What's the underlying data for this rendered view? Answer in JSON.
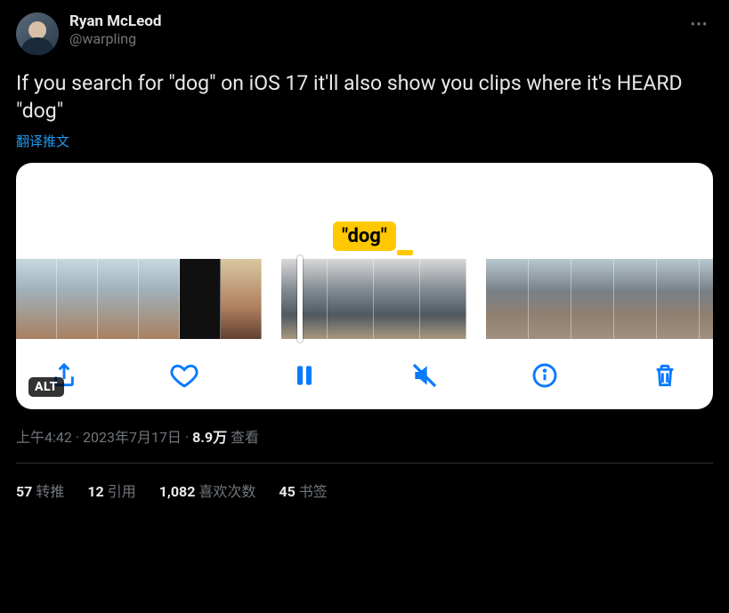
{
  "author": {
    "display_name": "Ryan McLeod",
    "handle": "@warpling"
  },
  "tweet_text": "If you search for \"dog\" on iOS 17 it'll also show you clips where it's HEARD \"dog\"",
  "translate_label": "翻译推文",
  "media": {
    "keyword_tag": "\"dog\"",
    "alt_badge": "ALT",
    "toolbar_icons": {
      "share": "share-icon",
      "like": "heart-icon",
      "pause": "pause-icon",
      "mute": "mute-icon",
      "info": "info-icon",
      "delete": "trash-icon"
    }
  },
  "meta": {
    "time": "上午4:42",
    "date": "2023年7月17日",
    "views_count": "8.9万",
    "views_label": "查看",
    "separator": " · "
  },
  "stats": {
    "retweets": {
      "count": "57",
      "label": "转推"
    },
    "quotes": {
      "count": "12",
      "label": "引用"
    },
    "likes": {
      "count": "1,082",
      "label": "喜欢次数"
    },
    "bookmarks": {
      "count": "45",
      "label": "书签"
    }
  },
  "more_icon": "⋯"
}
